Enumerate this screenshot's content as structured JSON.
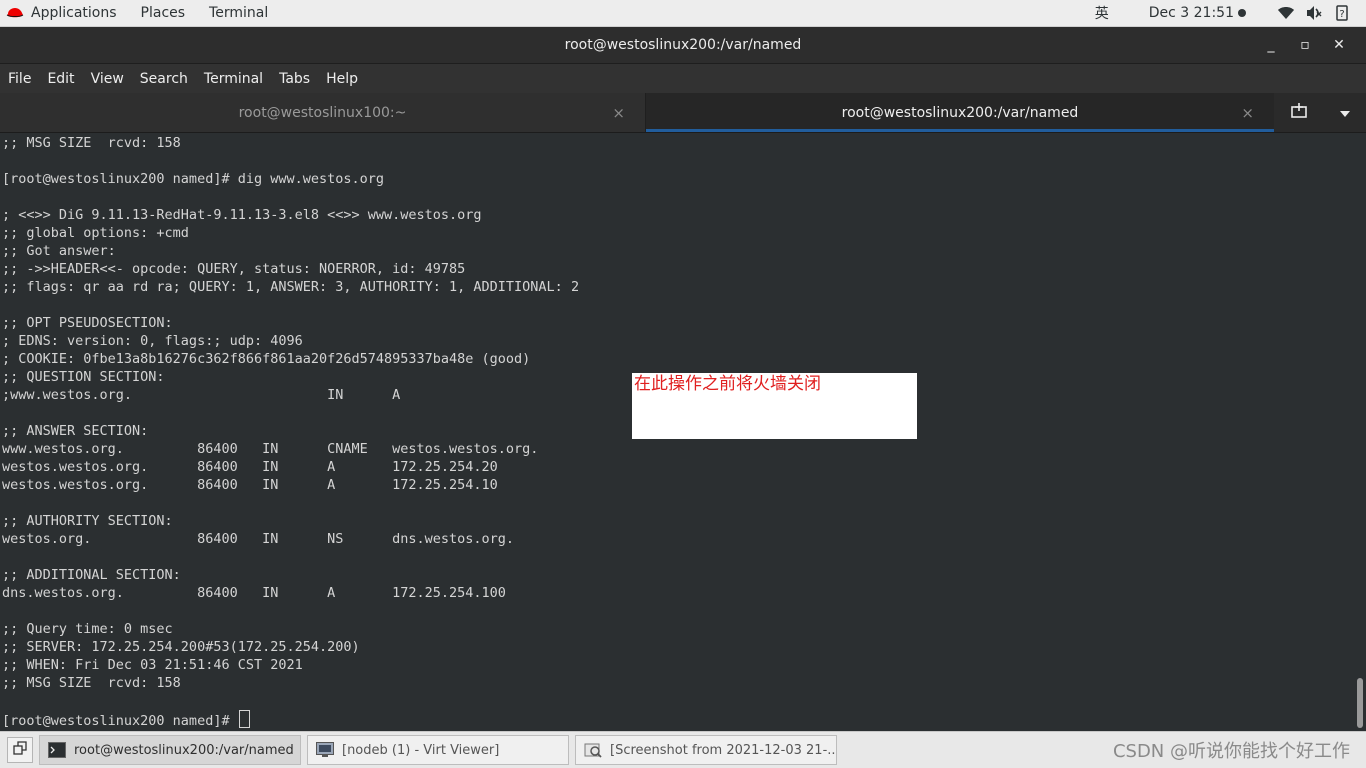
{
  "top_bar": {
    "applications": "Applications",
    "places": "Places",
    "terminal": "Terminal",
    "input_method": "英",
    "clock": "Dec 3  21:51",
    "icons": [
      "redhat-icon",
      "wifi-icon",
      "volume-icon",
      "power-icon"
    ]
  },
  "window": {
    "title": "root@westoslinux200:/var/named",
    "minimize": "_",
    "maximize": "▫",
    "close": "✕"
  },
  "menu": [
    "File",
    "Edit",
    "View",
    "Search",
    "Terminal",
    "Tabs",
    "Help"
  ],
  "tabs": [
    {
      "label": "root@westoslinux100:~",
      "close": "×",
      "active": false
    },
    {
      "label": "root@westoslinux200:/var/named",
      "close": "×",
      "active": true
    }
  ],
  "terminal": {
    "lines": [
      ";; MSG SIZE  rcvd: 158",
      "",
      "[root@westoslinux200 named]# dig www.westos.org",
      "",
      "; <<>> DiG 9.11.13-RedHat-9.11.13-3.el8 <<>> www.westos.org",
      ";; global options: +cmd",
      ";; Got answer:",
      ";; ->>HEADER<<- opcode: QUERY, status: NOERROR, id: 49785",
      ";; flags: qr aa rd ra; QUERY: 1, ANSWER: 3, AUTHORITY: 1, ADDITIONAL: 2",
      "",
      ";; OPT PSEUDOSECTION:",
      "; EDNS: version: 0, flags:; udp: 4096",
      "; COOKIE: 0fbe13a8b16276c362f866f861aa20f26d574895337ba48e (good)",
      ";; QUESTION SECTION:",
      ";www.westos.org.                        IN      A",
      "",
      ";; ANSWER SECTION:",
      "www.westos.org.         86400   IN      CNAME   westos.westos.org.",
      "westos.westos.org.      86400   IN      A       172.25.254.20",
      "westos.westos.org.      86400   IN      A       172.25.254.10",
      "",
      ";; AUTHORITY SECTION:",
      "westos.org.             86400   IN      NS      dns.westos.org.",
      "",
      ";; ADDITIONAL SECTION:",
      "dns.westos.org.         86400   IN      A       172.25.254.100",
      "",
      ";; Query time: 0 msec",
      ";; SERVER: 172.25.254.200#53(172.25.254.200)",
      ";; WHEN: Fri Dec 03 21:51:46 CST 2021",
      ";; MSG SIZE  rcvd: 158",
      "",
      "[root@westoslinux200 named]# "
    ]
  },
  "annotation": "在此操作之前将火墙关闭",
  "taskbar": {
    "tasks": [
      {
        "label": "root@westoslinux200:/var/named",
        "active": true
      },
      {
        "label": "[nodeb (1) - Virt Viewer]",
        "active": false
      },
      {
        "label": "[Screenshot from 2021-12-03 21-...",
        "active": false
      }
    ],
    "watermark": "CSDN @听说你能找个好工作"
  }
}
